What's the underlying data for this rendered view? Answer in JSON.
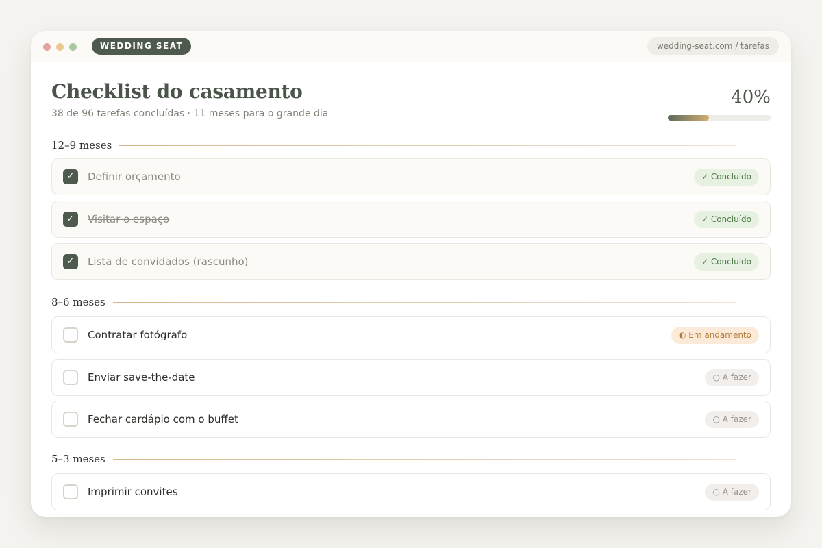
{
  "app": {
    "brand": "WEDDING SEAT",
    "url": "wedding-seat.com / tarefas"
  },
  "header": {
    "title": "Checklist do casamento",
    "subtitle": "38 de 96 tarefas concluídas · 11 meses para o grande dia",
    "progress_label": "40%",
    "progress_fraction": 0.4
  },
  "colors": {
    "brand": "#4f5a4e",
    "accent_gold": "#d3ad73",
    "done_badge_bg": "#e7f1e2",
    "progress_badge_bg": "#fbead7",
    "todo_badge_bg": "#f2eeec"
  },
  "groups": [
    {
      "label": "12–9 meses",
      "tasks": [
        {
          "label": "Definir orçamento",
          "checked": true,
          "status": "✓ Concluído"
        },
        {
          "label": "Visitar o espaço",
          "checked": true,
          "status": "✓ Concluído"
        },
        {
          "label": "Lista de convidados (rascunho)",
          "checked": true,
          "status": "✓ Concluído"
        }
      ]
    },
    {
      "label": "8–6 meses",
      "tasks": [
        {
          "label": "Contratar fotógrafo",
          "checked": false,
          "status": "◐ Em andamento"
        },
        {
          "label": "Enviar save-the-date",
          "checked": false,
          "status": "○ A fazer"
        },
        {
          "label": "Fechar cardápio com o buffet",
          "checked": false,
          "status": "○ A fazer"
        }
      ]
    },
    {
      "label": "5–3 meses",
      "tasks": [
        {
          "label": "Imprimir convites",
          "checked": false,
          "status": "○ A fazer"
        }
      ]
    }
  ]
}
